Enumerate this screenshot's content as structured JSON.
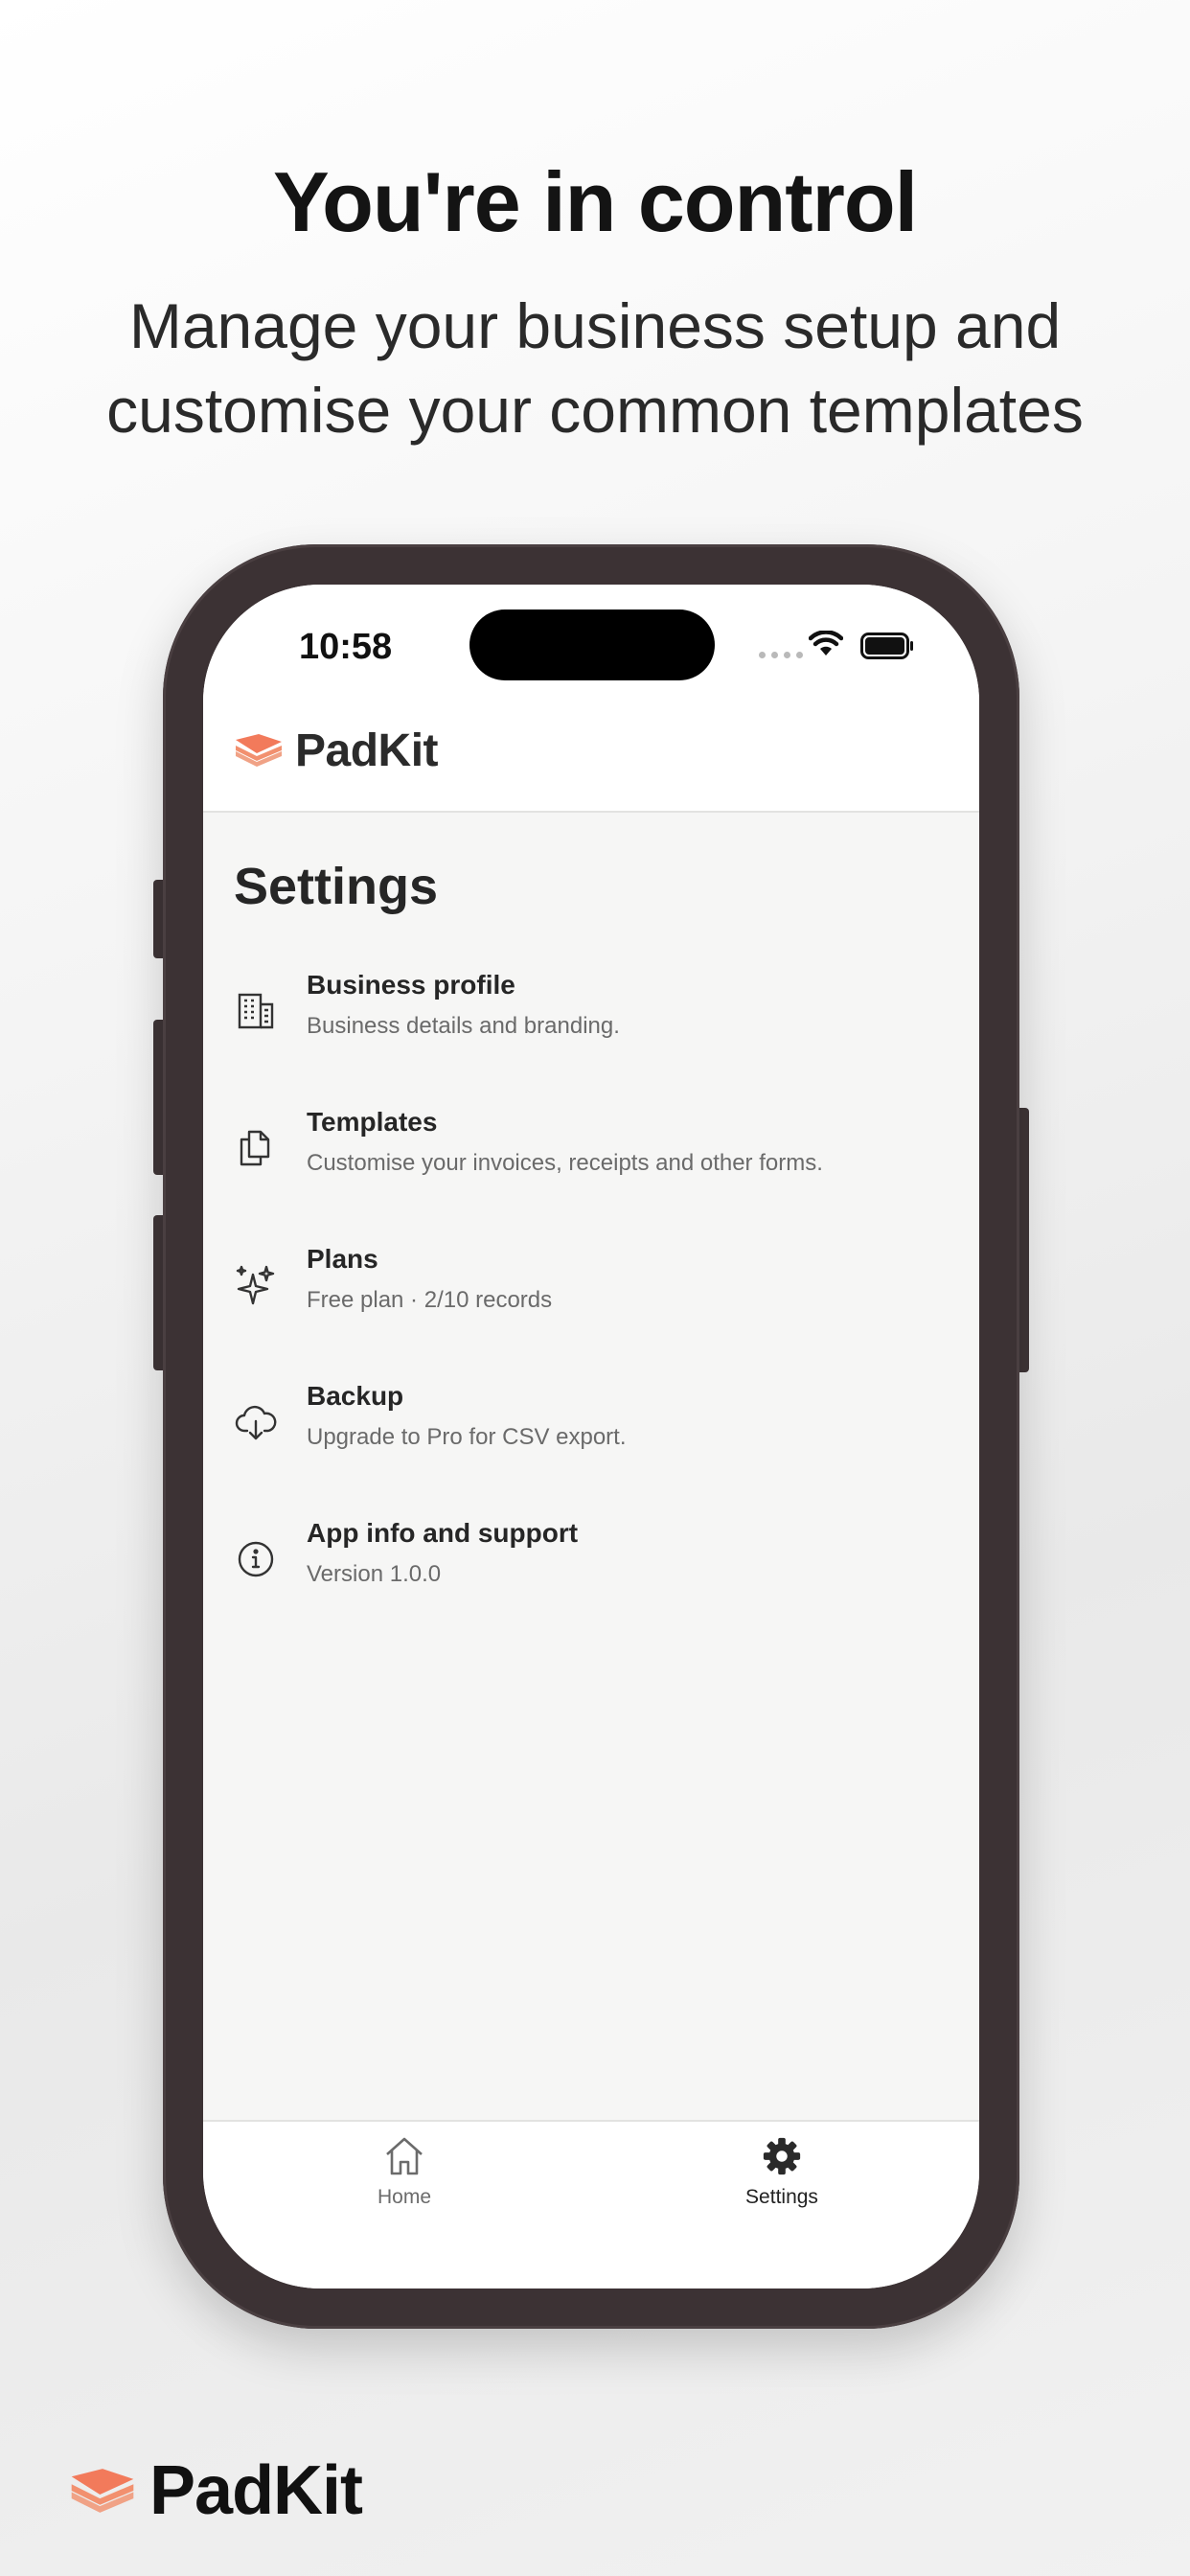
{
  "hero": {
    "title": "You're in control",
    "subtitle": "Manage your business setup and customise your common templates"
  },
  "status_bar": {
    "time": "10:58"
  },
  "app": {
    "brand": "PadKit",
    "brand_color": "#f27a5b"
  },
  "settings": {
    "title": "Settings",
    "items": [
      {
        "icon": "building-icon",
        "title": "Business profile",
        "subtitle": "Business details and branding."
      },
      {
        "icon": "document-copy-icon",
        "title": "Templates",
        "subtitle": "Customise your invoices, receipts and other forms."
      },
      {
        "icon": "sparkles-icon",
        "title": "Plans",
        "subtitle": "Free plan · 2/10 records"
      },
      {
        "icon": "cloud-download-icon",
        "title": "Backup",
        "subtitle": "Upgrade to Pro for CSV export."
      },
      {
        "icon": "info-icon",
        "title": "App info and support",
        "subtitle": "Version 1.0.0"
      }
    ]
  },
  "tabbar": {
    "tabs": [
      {
        "icon": "home-icon",
        "label": "Home",
        "active": false
      },
      {
        "icon": "gear-icon",
        "label": "Settings",
        "active": true
      }
    ]
  },
  "footer": {
    "brand": "PadKit"
  }
}
